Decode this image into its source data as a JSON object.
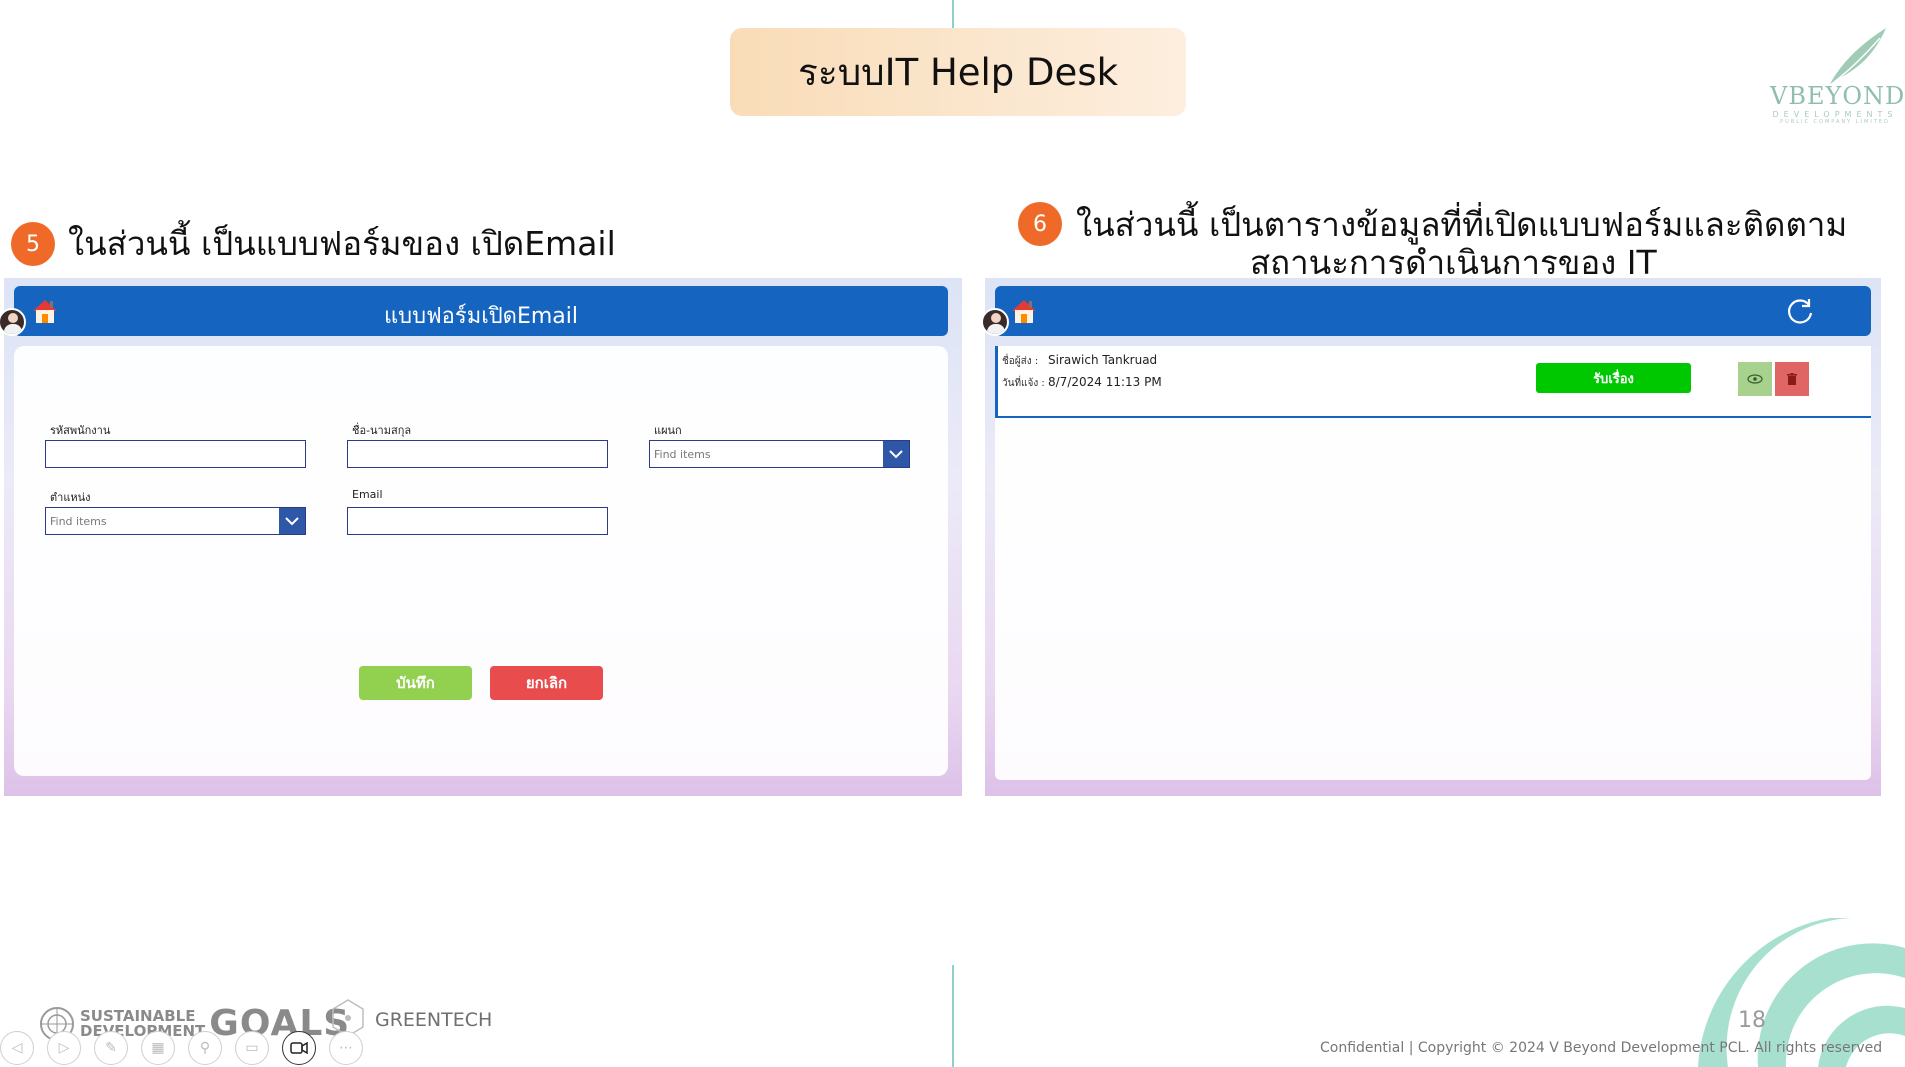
{
  "slide": {
    "title": "ระบบIT Help Desk",
    "page_number": "18",
    "copyright": "Confidential | Copyright © 2024 V Beyond Development PCL. All rights reserved"
  },
  "logo": {
    "brand": "VBEYOND",
    "sub": "DEVELOPMENTS",
    "sub2": "PUBLIC COMPANY LIMITED"
  },
  "section5": {
    "badge": "5",
    "heading": "ในส่วนนี้ เป็นแบบฟอร์มของ เปิดEmail"
  },
  "section6": {
    "badge": "6",
    "heading_line1": "ในส่วนนี้ เป็นตารางข้อมูลที่ที่เปิดแบบฟอร์มและติดตาม",
    "heading_line2": "สถานะการดำเนินการของ IT"
  },
  "form": {
    "title": "แบบฟอร์มเปิดEmail",
    "fields": {
      "employee_id": {
        "label": "รหัสพนักงาน",
        "value": ""
      },
      "full_name": {
        "label": "ชื่อ-นามสกุล",
        "value": ""
      },
      "department": {
        "label": "แผนก",
        "placeholder": "Find items"
      },
      "position": {
        "label": "ตำแหน่ง",
        "placeholder": "Find items"
      },
      "email": {
        "label": "Email",
        "value": ""
      }
    },
    "save_label": "บันทึก",
    "cancel_label": "ยกเลิก",
    "colors": {
      "save": "#92d050",
      "cancel": "#e84c4c",
      "appbar": "#1565c0"
    }
  },
  "list": {
    "items": [
      {
        "sender_label": "ชื่อผู้ส่ง :",
        "sender_value": "Sirawich Tankruad",
        "date_label": "วันที่แจ้ง :",
        "date_value": "8/7/2024 11:13 PM",
        "accept_label": "รับเรื่อง"
      }
    ],
    "colors": {
      "accept": "#00c800",
      "view": "#a9d18e",
      "delete": "#e06666"
    }
  },
  "footer": {
    "sdg_line1": "SUSTAINABLE",
    "sdg_line2": "DEVELOPMENT",
    "goals": "GOALS",
    "greentech": "GREENTECH"
  },
  "icons": [
    "home-icon",
    "avatar",
    "refresh-icon",
    "eye-icon",
    "trash-icon",
    "chevron-down-icon"
  ]
}
